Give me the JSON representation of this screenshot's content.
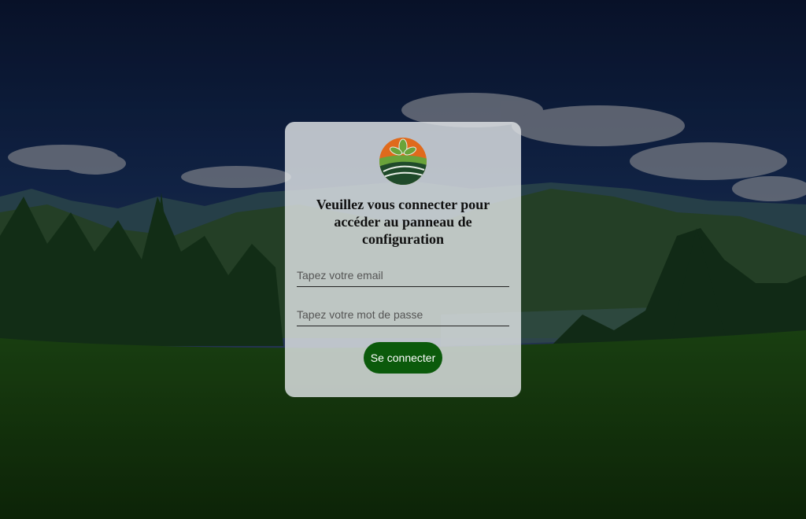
{
  "login": {
    "heading": "Veuillez vous connecter pour accéder au panneau de configuration",
    "email_placeholder": "Tapez votre email",
    "password_placeholder": "Tapez votre mot de passe",
    "submit_label": "Se connecter"
  },
  "colors": {
    "button": "#0b5a0b",
    "card": "#e1e4e6",
    "logo_orange": "#e06a1c",
    "logo_green": "#6aa33a",
    "logo_dark": "#1f4a2a"
  },
  "background": {
    "scene": "mountain-landscape"
  }
}
